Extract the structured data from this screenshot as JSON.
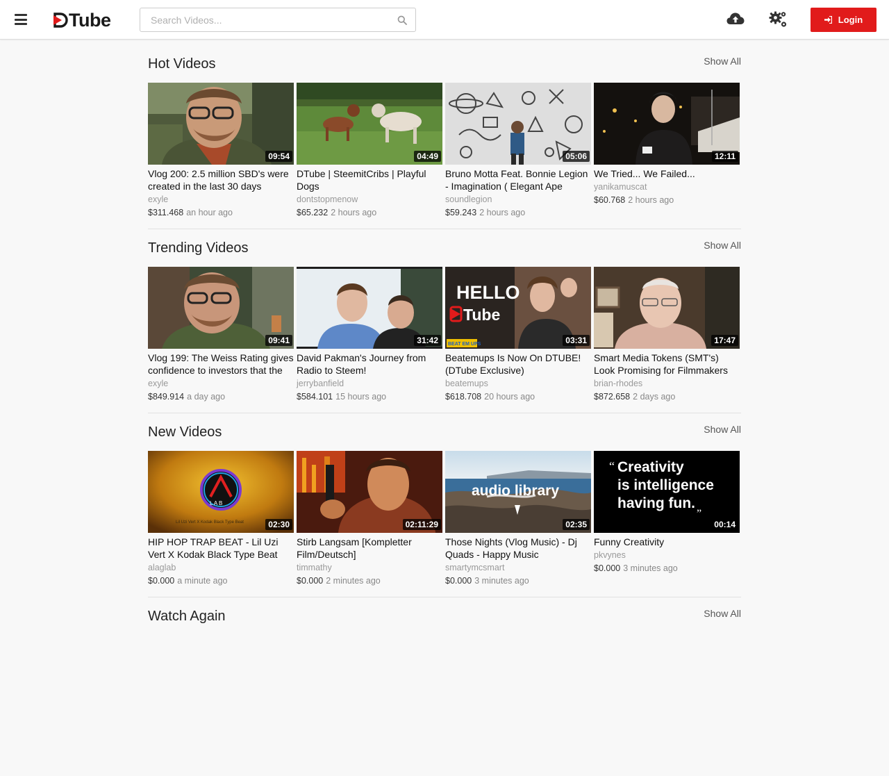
{
  "header": {
    "logo_text": "Tube",
    "search_placeholder": "Search Videos...",
    "login_label": "Login"
  },
  "colors": {
    "accent": "#e11b1b",
    "background": "#f8f8f8"
  },
  "icons": [
    "menu-icon",
    "search-icon",
    "upload-cloud-icon",
    "settings-gears-icon",
    "login-icon"
  ],
  "sections": [
    {
      "title": "Hot Videos",
      "show_all": "Show All",
      "videos": [
        {
          "title": "Vlog 200: 2.5 million SBD's were created in the last 30 days",
          "author": "exyle",
          "value": "$311.468",
          "ago": "an hour ago",
          "duration": "09:54"
        },
        {
          "title": "DTube | SteemitCribs | Playful Dogs",
          "author": "dontstopmenow",
          "value": "$65.232",
          "ago": "2 hours ago",
          "duration": "04:49"
        },
        {
          "title": "Bruno Motta Feat. Bonnie Legion - Imagination ( Elegant Ape",
          "author": "soundlegion",
          "value": "$59.243",
          "ago": "2 hours ago",
          "duration": "05:06"
        },
        {
          "title": "We Tried... We Failed...",
          "author": "yanikamuscat",
          "value": "$60.768",
          "ago": "2 hours ago",
          "duration": "12:11"
        }
      ]
    },
    {
      "title": "Trending Videos",
      "show_all": "Show All",
      "videos": [
        {
          "title": "Vlog 199: The Weiss Rating gives confidence to investors that the",
          "author": "exyle",
          "value": "$849.914",
          "ago": "a day ago",
          "duration": "09:41"
        },
        {
          "title": "David Pakman's Journey from Radio to Steem!",
          "author": "jerrybanfield",
          "value": "$584.101",
          "ago": "15 hours ago",
          "duration": "31:42"
        },
        {
          "title": "Beatemups Is Now On DTUBE! (DTube Exclusive)",
          "author": "beatemups",
          "value": "$618.708",
          "ago": "20 hours ago",
          "duration": "03:31"
        },
        {
          "title": "Smart Media Tokens (SMT's) Look Promising for Filmmakers",
          "author": "brian-rhodes",
          "value": "$872.658",
          "ago": "2 days ago",
          "duration": "17:47"
        }
      ]
    },
    {
      "title": "New Videos",
      "show_all": "Show All",
      "videos": [
        {
          "title": "HIP HOP TRAP BEAT - Lil Uzi Vert X Kodak Black Type Beat",
          "author": "alaglab",
          "value": "$0.000",
          "ago": "a minute ago",
          "duration": "02:30"
        },
        {
          "title": "Stirb Langsam [Kompletter Film/Deutsch]",
          "author": "timmathy",
          "value": "$0.000",
          "ago": "2 minutes ago",
          "duration": "02:11:29"
        },
        {
          "title": "Those Nights (Vlog Music) - Dj Quads - Happy Music",
          "author": "smartymcsmart",
          "value": "$0.000",
          "ago": "3 minutes ago",
          "duration": "02:35"
        },
        {
          "title": "Funny Creativity",
          "author": "pkvynes",
          "value": "$0.000",
          "ago": "3 minutes ago",
          "duration": "00:14"
        }
      ]
    },
    {
      "title": "Watch Again",
      "show_all": "Show All",
      "videos": []
    }
  ],
  "thumb_text": {
    "hello": "HELLO",
    "dtube": "Tube",
    "beatemups": "BEAT EM UPS",
    "lab": "L A B",
    "lab_caption": "Lil Uzi Vert X Kodak Black Type Beat",
    "audio_library": "audio library",
    "quote_line1": "Creativity",
    "quote_line2": "is intelligence",
    "quote_line3": "having fun."
  }
}
